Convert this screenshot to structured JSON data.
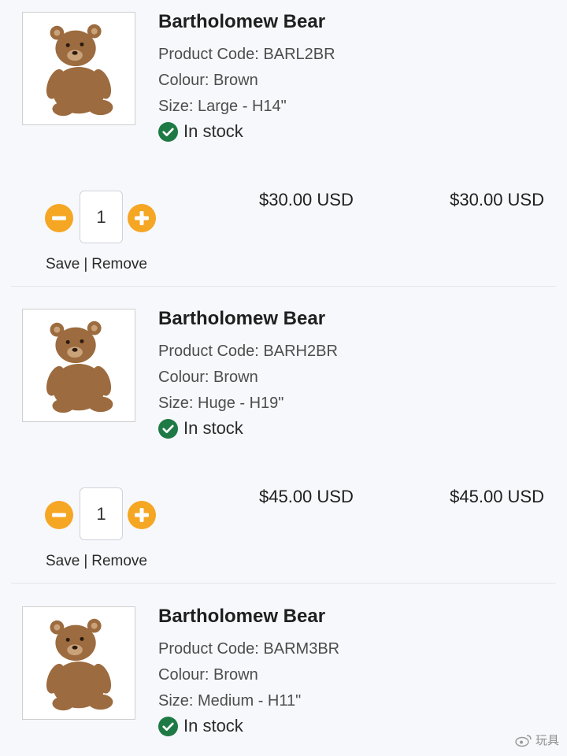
{
  "colors": {
    "accent": "#f5a623",
    "in_stock": "#1e7a44",
    "bear_fur": "#9c6b3f"
  },
  "icons": {
    "decrease": "minus-circle-icon",
    "increase": "plus-circle-icon",
    "stock": "check-circle-icon"
  },
  "cart": {
    "items": [
      {
        "name": "Bartholomew Bear",
        "code": "Product Code: BARL2BR",
        "colour": "Colour: Brown",
        "size": "Size: Large - H14\"",
        "stock": "In stock",
        "quantity": "1",
        "unit_price": "$30.00 USD",
        "total": "$30.00 USD",
        "save_label": "Save",
        "separator": "|",
        "remove_label": "Remove"
      },
      {
        "name": "Bartholomew Bear",
        "code": "Product Code: BARH2BR",
        "colour": "Colour: Brown",
        "size": "Size: Huge - H19\"",
        "stock": "In stock",
        "quantity": "1",
        "unit_price": "$45.00 USD",
        "total": "$45.00 USD",
        "save_label": "Save",
        "separator": "|",
        "remove_label": "Remove"
      },
      {
        "name": "Bartholomew Bear",
        "code": "Product Code: BARM3BR",
        "colour": "Colour: Brown",
        "size": "Size: Medium - H11\"",
        "stock": "In stock"
      }
    ]
  },
  "watermark": {
    "text": "玩具"
  }
}
